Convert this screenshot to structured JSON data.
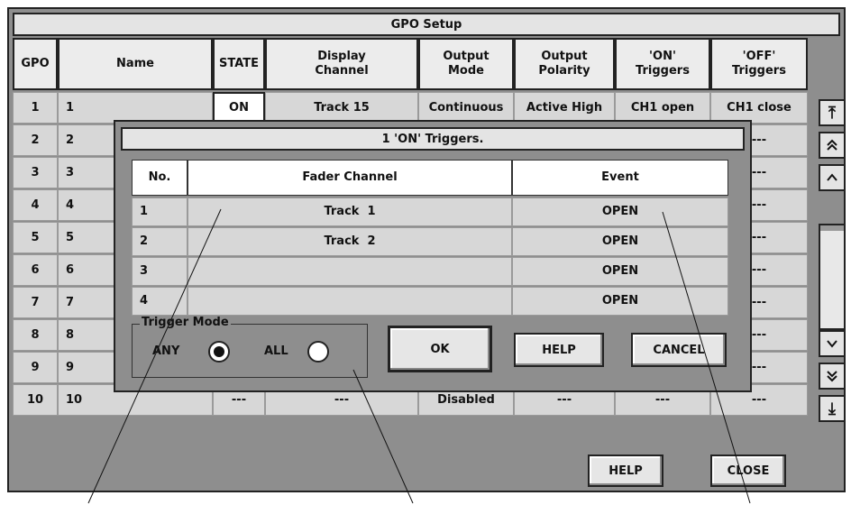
{
  "window": {
    "title": "GPO Setup"
  },
  "table": {
    "headers": [
      "GPO",
      "Name",
      "STATE",
      "Display\nChannel",
      "Output\nMode",
      "Output\nPolarity",
      "'ON'\nTriggers",
      "'OFF'\nTriggers"
    ],
    "rows": [
      [
        "1",
        "1",
        "ON",
        "Track 15",
        "Continuous",
        "Active High",
        "CH1 open",
        "CH1 close"
      ],
      [
        "2",
        "2",
        "",
        "",
        "",
        "",
        "",
        "---"
      ],
      [
        "3",
        "3",
        "",
        "",
        "",
        "",
        "",
        "---"
      ],
      [
        "4",
        "4",
        "",
        "",
        "",
        "",
        "",
        "---"
      ],
      [
        "5",
        "5",
        "",
        "",
        "",
        "",
        "",
        "---"
      ],
      [
        "6",
        "6",
        "",
        "",
        "",
        "",
        "",
        "---"
      ],
      [
        "7",
        "7",
        "",
        "",
        "",
        "",
        "",
        "---"
      ],
      [
        "8",
        "8",
        "",
        "",
        "",
        "",
        "",
        "---"
      ],
      [
        "9",
        "9",
        "",
        "",
        "",
        "",
        "",
        "---"
      ],
      [
        "10",
        "10",
        "---",
        "---",
        "Disabled",
        "---",
        "---",
        "---"
      ]
    ]
  },
  "scrollbar": {
    "top_icon": "⤒",
    "page_up_icon": "⌃",
    "up_icon": "^",
    "down_icon": "v",
    "page_down_icon": "⌄",
    "bottom_icon": "⤓"
  },
  "footer": {
    "help_label": "HELP",
    "close_label": "CLOSE"
  },
  "dialog": {
    "title": "1 'ON' Triggers.",
    "headers": [
      "No.",
      "Fader Channel",
      "Event"
    ],
    "rows": [
      [
        "1",
        "Track  1",
        "OPEN"
      ],
      [
        "2",
        "Track  2",
        "OPEN"
      ],
      [
        "3",
        "",
        "OPEN"
      ],
      [
        "4",
        "",
        "OPEN"
      ]
    ],
    "trigger_mode": {
      "label": "Trigger Mode",
      "any_label": "ANY",
      "all_label": "ALL",
      "selected": "ANY"
    },
    "buttons": {
      "ok": "OK",
      "help": "HELP",
      "cancel": "CANCEL"
    }
  },
  "colors": {
    "panel": "#8e8e8e",
    "cell": "#d7d7d7",
    "header": "#ececec",
    "border": "#222222"
  }
}
